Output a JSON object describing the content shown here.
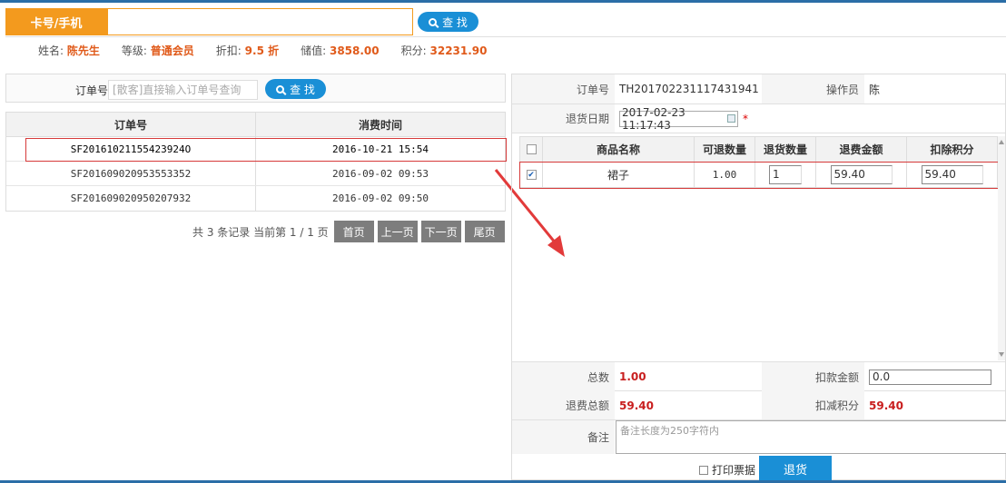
{
  "search_card": {
    "label": "卡号/手机",
    "value": "",
    "button": "查 找"
  },
  "member": {
    "name_label": "姓名:",
    "name": "陈先生",
    "level_label": "等级:",
    "level": "普通会员",
    "discount_label": "折扣:",
    "discount": "9.5 折",
    "balance_label": "储值:",
    "balance": "3858.00",
    "points_label": "积分:",
    "points": "32231.90"
  },
  "order_search": {
    "label": "订单号",
    "placeholder": "[散客]直接输入订单号查询",
    "button": "查 找"
  },
  "orders_table": {
    "columns": [
      "订单号",
      "消费时间"
    ],
    "rows": [
      {
        "order_no": "SF20161021155423924O",
        "time": "2016-10-21 15:54"
      },
      {
        "order_no": "SF201609020953553352",
        "time": "2016-09-02 09:53"
      },
      {
        "order_no": "SF201609020950207932",
        "time": "2016-09-02 09:50"
      }
    ]
  },
  "pager": {
    "summary": "共 3 条记录 当前第 1 / 1 页",
    "first": "首页",
    "prev": "上一页",
    "next": "下一页",
    "last": "尾页"
  },
  "return_form": {
    "order_label": "订单号",
    "order_no": "TH201702231117431941",
    "operator_label": "操作员",
    "operator": "陈",
    "date_label": "退货日期",
    "date": "2017-02-23 11:17:43",
    "required_mark": "*"
  },
  "items_table": {
    "columns": [
      "商品名称",
      "可退数量",
      "退货数量",
      "退费金额",
      "扣除积分"
    ],
    "rows": [
      {
        "checked": true,
        "check_mark": "✔",
        "name": "裙子",
        "returnable_qty": "1.00",
        "return_qty": "1",
        "refund": "59.40",
        "deduct_points": "59.40"
      }
    ]
  },
  "summary": {
    "total_label": "总数",
    "total": "1.00",
    "deduct_amount_label": "扣款金额",
    "deduct_amount": "0.0",
    "refund_total_label": "退费总额",
    "refund_total": "59.40",
    "deduct_points_label": "扣减积分",
    "deduct_points": "59.40",
    "note_label": "备注",
    "note_placeholder": "备注长度为250字符内"
  },
  "actions": {
    "print_label": "打印票据",
    "return_button": "退货"
  },
  "colors": {
    "orange": "#f39a1e",
    "blue": "#1a8fd6",
    "highlight_red": "#d63a3a",
    "value_red": "#c81e1e",
    "value_orange": "#e05a1a"
  }
}
